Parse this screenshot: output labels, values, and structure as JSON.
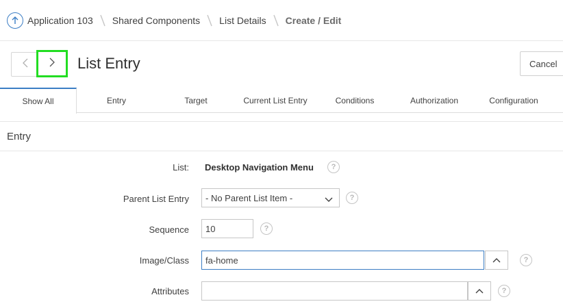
{
  "breadcrumb": {
    "items": [
      "Application 103",
      "Shared Components",
      "List Details"
    ],
    "current": "Create / Edit"
  },
  "header": {
    "title": "List Entry",
    "cancel_label": "Cancel"
  },
  "tabs": [
    "Show All",
    "Entry",
    "Target",
    "Current List Entry",
    "Conditions",
    "Authorization",
    "Configuration"
  ],
  "active_tab": "Show All",
  "region": {
    "title": "Entry"
  },
  "form": {
    "list": {
      "label": "List:",
      "value": "Desktop Navigation Menu"
    },
    "parent": {
      "label": "Parent List Entry",
      "value": "- No Parent List Item -"
    },
    "sequence": {
      "label": "Sequence",
      "value": "10"
    },
    "image_class": {
      "label": "Image/Class",
      "value": "fa-home"
    },
    "attributes": {
      "label": "Attributes",
      "value": ""
    }
  },
  "help_glyph": "?",
  "colors": {
    "accent": "#3b7dc4",
    "highlight": "#22dd22"
  },
  "icons": [
    "up-arrow-icon",
    "chevron-left-icon",
    "chevron-right-icon",
    "chevron-down-icon",
    "chevron-up-icon",
    "help-icon"
  ]
}
